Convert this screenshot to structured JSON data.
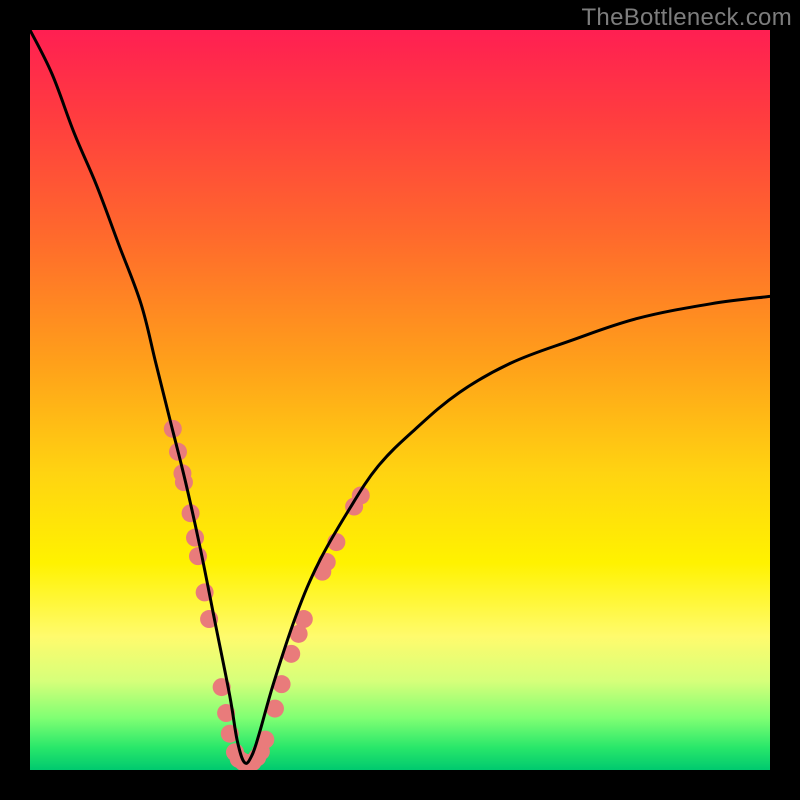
{
  "watermark": "TheBottleneck.com",
  "chart_data": {
    "type": "line",
    "title": "",
    "xlabel": "",
    "ylabel": "",
    "xlim": [
      0,
      100
    ],
    "ylim": [
      0,
      100
    ],
    "note": "Bottleneck curve. y ≈ 100 at left edge, drops to ≈0 at trough near x≈29, rises to ≈64 at right edge. Values estimated from pixels; no axes/ticks rendered.",
    "series": [
      {
        "name": "bottleneck-curve",
        "x": [
          0,
          3,
          6,
          9,
          12,
          15,
          17,
          19,
          21,
          23,
          25,
          27,
          28,
          29,
          30,
          31,
          33,
          36,
          39,
          43,
          47,
          52,
          58,
          65,
          73,
          82,
          92,
          100
        ],
        "values": [
          100,
          94,
          86,
          79,
          71,
          63,
          55,
          47,
          39,
          30,
          20,
          10,
          4,
          1,
          2,
          5,
          12,
          21,
          28,
          35,
          41,
          46,
          51,
          55,
          58,
          61,
          63,
          64
        ]
      }
    ],
    "markers": {
      "name": "sample-dots",
      "color": "#e97b7b",
      "radius_px": 9,
      "points": [
        {
          "x": 19.3,
          "y": 46.1
        },
        {
          "x": 20.0,
          "y": 43.0
        },
        {
          "x": 20.6,
          "y": 40.1
        },
        {
          "x": 20.8,
          "y": 38.9
        },
        {
          "x": 21.7,
          "y": 34.7
        },
        {
          "x": 22.3,
          "y": 31.4
        },
        {
          "x": 22.7,
          "y": 28.9
        },
        {
          "x": 23.6,
          "y": 24.0
        },
        {
          "x": 24.2,
          "y": 20.4
        },
        {
          "x": 25.9,
          "y": 11.2
        },
        {
          "x": 26.5,
          "y": 7.7
        },
        {
          "x": 27.0,
          "y": 4.9
        },
        {
          "x": 27.7,
          "y": 2.4
        },
        {
          "x": 28.2,
          "y": 1.5
        },
        {
          "x": 28.8,
          "y": 1.1
        },
        {
          "x": 29.5,
          "y": 0.9
        },
        {
          "x": 30.1,
          "y": 1.1
        },
        {
          "x": 30.7,
          "y": 1.7
        },
        {
          "x": 31.2,
          "y": 2.5
        },
        {
          "x": 31.8,
          "y": 4.1
        },
        {
          "x": 33.1,
          "y": 8.3
        },
        {
          "x": 34.0,
          "y": 11.6
        },
        {
          "x": 35.3,
          "y": 15.7
        },
        {
          "x": 36.3,
          "y": 18.4
        },
        {
          "x": 37.0,
          "y": 20.4
        },
        {
          "x": 39.5,
          "y": 26.8
        },
        {
          "x": 40.1,
          "y": 28.1
        },
        {
          "x": 41.4,
          "y": 30.8
        },
        {
          "x": 43.8,
          "y": 35.6
        },
        {
          "x": 44.7,
          "y": 37.1
        }
      ]
    },
    "background_gradient": {
      "direction": "top-to-bottom",
      "stops": [
        {
          "pos": 0.0,
          "color": "#ff1f52"
        },
        {
          "pos": 0.12,
          "color": "#ff3d3f"
        },
        {
          "pos": 0.28,
          "color": "#ff6a2c"
        },
        {
          "pos": 0.45,
          "color": "#ffa01a"
        },
        {
          "pos": 0.6,
          "color": "#ffd411"
        },
        {
          "pos": 0.72,
          "color": "#fff200"
        },
        {
          "pos": 0.82,
          "color": "#fffb6d"
        },
        {
          "pos": 0.88,
          "color": "#d6ff7a"
        },
        {
          "pos": 0.93,
          "color": "#7fff73"
        },
        {
          "pos": 0.97,
          "color": "#28e76a"
        },
        {
          "pos": 1.0,
          "color": "#00c96f"
        }
      ]
    }
  }
}
